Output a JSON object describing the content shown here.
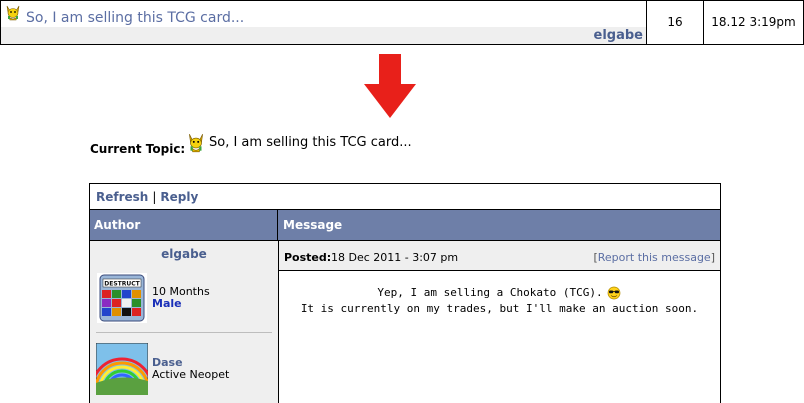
{
  "listing": {
    "topic_title": "So, I am selling this TCG card...",
    "author": "elgabe",
    "replies": "16",
    "last_post": "18.12 3:19pm"
  },
  "current_topic": {
    "label": "Current Topic:",
    "title": "So, I am selling this TCG card..."
  },
  "board": {
    "actions": {
      "refresh": "Refresh",
      "separator": "|",
      "reply": "Reply"
    },
    "headers": {
      "author": "Author",
      "message": "Message"
    },
    "post": {
      "author_name": "elgabe",
      "account_age": "10 Months",
      "gender": "Male",
      "pet_name": "Dase",
      "pet_status": "Active Neopet",
      "posted_label": "Posted:",
      "posted_date": "18 Dec 2011 - 3:07 pm",
      "report_open": "[",
      "report_label": "Report this message",
      "report_close": "]",
      "message_line1": "Yep, I am selling a Chokato (TCG).",
      "message_line2": "It is currently on my trades, but I'll make an auction soon."
    }
  },
  "colors": {
    "header_bg": "#6e7fa8",
    "link": "#4a5f8f",
    "row_bg": "#efefef",
    "arrow": "#e8201a",
    "gender": "#1a2fb8"
  },
  "icons": {
    "topic_icon": "yellow-pet-icon",
    "arrow": "arrow-down-icon",
    "emoji": "sunglasses-smiley-icon"
  }
}
